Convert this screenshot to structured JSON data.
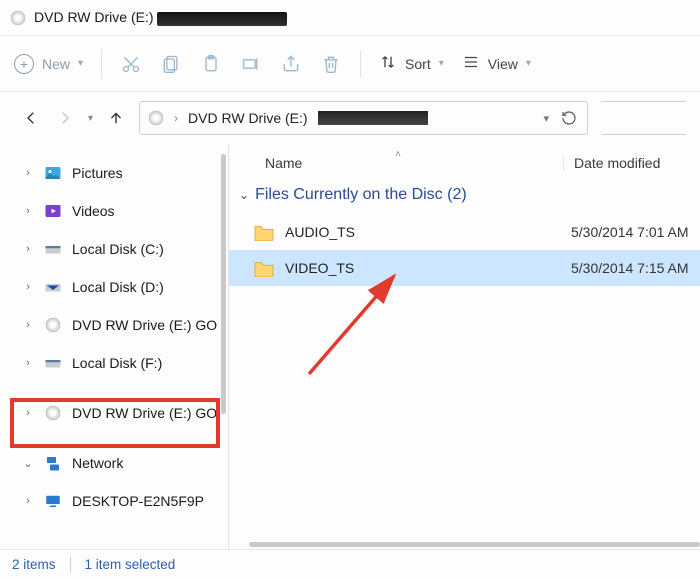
{
  "titlebar": {
    "title_prefix": "DVD RW Drive (E:)"
  },
  "toolbar": {
    "new_label": "New",
    "sort_label": "Sort",
    "view_label": "View"
  },
  "address": {
    "path_label": "DVD RW Drive (E:)"
  },
  "tree": {
    "items": [
      {
        "label": "Pictures",
        "icon": "pictures",
        "expandable": true
      },
      {
        "label": "Videos",
        "icon": "videos",
        "expandable": true
      },
      {
        "label": "Local Disk (C:)",
        "icon": "drive",
        "expandable": true
      },
      {
        "label": "Local Disk (D:)",
        "icon": "drive-d",
        "expandable": true
      },
      {
        "label": "DVD RW Drive (E:) GO",
        "icon": "disc",
        "expandable": true
      },
      {
        "label": "Local Disk (F:)",
        "icon": "drive",
        "expandable": true
      },
      {
        "label": "DVD RW Drive (E:) GOI",
        "icon": "disc",
        "expandable": true,
        "highlighted": true
      },
      {
        "label": "Network",
        "icon": "network",
        "expanded": true
      },
      {
        "label": "DESKTOP-E2N5F9P",
        "icon": "pc",
        "expandable": true,
        "indent": 2
      }
    ]
  },
  "columns": {
    "name": "Name",
    "date": "Date modified"
  },
  "group": {
    "label": "Files Currently on the Disc (2)"
  },
  "files": [
    {
      "name": "AUDIO_TS",
      "date": "5/30/2014 7:01 AM",
      "selected": false
    },
    {
      "name": "VIDEO_TS",
      "date": "5/30/2014 7:15 AM",
      "selected": true
    }
  ],
  "status": {
    "items": "2 items",
    "selected": "1 item selected"
  }
}
